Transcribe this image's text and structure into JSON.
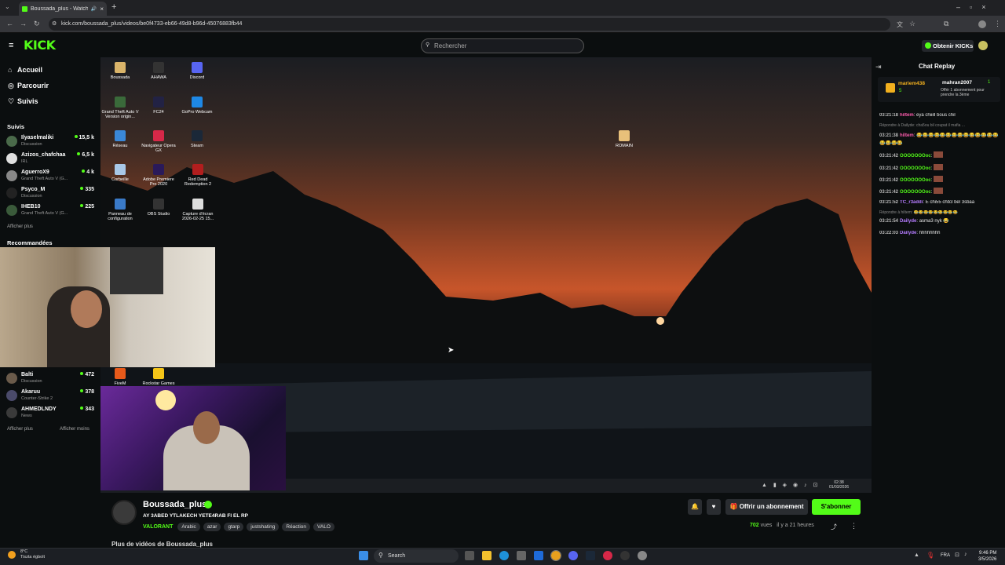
{
  "browser": {
    "tab_title": "Boussada_plus - Watch the",
    "url": "kick.com/boussada_plus/videos/be0f4733-eb66-49d8-b96d-45076883fb44",
    "new_tab": "+"
  },
  "header": {
    "logo": "KICK",
    "search_placeholder": "Rechercher",
    "kicks_button": "Obtenir KICKs"
  },
  "sidebar": {
    "nav": [
      {
        "label": "Accueil",
        "icon": "home-icon"
      },
      {
        "label": "Parcourir",
        "icon": "compass-icon"
      },
      {
        "label": "Suivis",
        "icon": "heart-icon"
      }
    ],
    "followed_title": "Suivis",
    "followed": [
      {
        "name": "Ilyaselmaliki",
        "category": "Discussion",
        "viewers": "15,5 k"
      },
      {
        "name": "Azizos_chafchaa",
        "category": "IRL",
        "viewers": "6,5 k"
      },
      {
        "name": "AguerroX9",
        "category": "Grand Theft Auto V (G...",
        "viewers": "4 k"
      },
      {
        "name": "Psyco_M",
        "category": "Discussion",
        "viewers": "335"
      },
      {
        "name": "IHEB10",
        "category": "Grand Theft Auto V (G...",
        "viewers": "225"
      }
    ],
    "show_more_1": "Afficher plus",
    "recommended_title": "Recommandées",
    "recommended": [
      {
        "name": "Balti",
        "category": "Discussion",
        "viewers": "472"
      },
      {
        "name": "Akaruu",
        "category": "Counter-Strike 2",
        "viewers": "378"
      },
      {
        "name": "AHMEDLNDY",
        "category": "News",
        "viewers": "343"
      }
    ],
    "show_more_2": "Afficher plus",
    "show_less": "Afficher moins"
  },
  "desktop": {
    "icons": [
      {
        "label": "Boussada",
        "color": "#d9b46a"
      },
      {
        "label": "AHAWA",
        "color": "#333333"
      },
      {
        "label": "Discord",
        "color": "#5865f2"
      },
      {
        "label": "Grand Theft Auto V Version origin...",
        "color": "#3a6a3a"
      },
      {
        "label": "FC24",
        "color": "#222244"
      },
      {
        "label": "GoPro Webcam",
        "color": "#1e88e5"
      },
      {
        "label": "Réseau",
        "color": "#3a88d8"
      },
      {
        "label": "Navigateur Opera GX",
        "color": "#d62848"
      },
      {
        "label": "Steam",
        "color": "#1b2838"
      },
      {
        "label": "Corbeille",
        "color": "#a8c8e8"
      },
      {
        "label": "Adobe Premiere Pro 2020",
        "color": "#2a1a5a"
      },
      {
        "label": "Red Dead Redemption 2",
        "color": "#b21e1e"
      },
      {
        "label": "Panneau de configuration",
        "color": "#3a7ac8"
      },
      {
        "label": "OBS Studio",
        "color": "#333333"
      },
      {
        "label": "Capture d'écran 2026-02-25 15...",
        "color": "#dddddd"
      },
      {
        "label": "ROMAIN",
        "color": "#e8c07a"
      },
      {
        "label": "FiveM",
        "color": "#e85a1a"
      },
      {
        "label": "Rockstar Games",
        "color": "#f5c518"
      }
    ],
    "tray_time": "02:38",
    "tray_date": "01/03/2026"
  },
  "chat": {
    "title": "Chat Replay",
    "pinned": {
      "user1": "mariem438",
      "count1": "5",
      "user2": "mahran2007",
      "count2": "1",
      "gift_text": "Offrir 1 abonnement pour prendre la 3ème"
    },
    "messages": [
      {
        "time": "03:21:18",
        "user": "hiltem",
        "user_color": "#ff5cae",
        "text": "eya chiiill bous chil"
      },
      {
        "reply": "Répondre à Dailyde: cha5ou bil coupat il mafia ..."
      },
      {
        "time": "03:21:38",
        "user": "hiltem",
        "user_color": "#ff5cae",
        "text": "😂😂😂😂😂😂😂😂😂😂😂😂😂😂😂😂😂😂"
      },
      {
        "time": "03:21:42",
        "user": "OOOOOOOoc",
        "user_color": "#53fc18",
        "text": ""
      },
      {
        "time": "03:21:42",
        "user": "OOOOOOOoc",
        "user_color": "#53fc18",
        "text": ""
      },
      {
        "time": "03:21:42",
        "user": "OOOOOOOoc",
        "user_color": "#53fc18",
        "text": ""
      },
      {
        "time": "03:21:42",
        "user": "OOOOOOOoc",
        "user_color": "#53fc18",
        "text": ""
      },
      {
        "time": "03:21:52",
        "user": "TC_r3addi",
        "user_color": "#b57cff",
        "text": "E chi55 chb3 bel 3sbaa"
      },
      {
        "reply": "Répondre à hiltem: 😂😂😂😂😂😂😂😂😂"
      },
      {
        "time": "03:21:54",
        "user": "Dailyde",
        "user_color": "#b57cff",
        "text": "asma3 nyk 😂"
      },
      {
        "time": "03:22:03",
        "user": "Dailyde",
        "user_color": "#b57cff",
        "text": "hhhhhhhh"
      }
    ]
  },
  "stream": {
    "channel": "Boussada_plus",
    "title": "AY 3ABED YTLAKECH YETE4RAB FI EL RP",
    "category": "VALORANT",
    "tags": [
      "Arabic",
      "azar",
      "gtarp",
      "justshating",
      "Réaction",
      "VALO"
    ],
    "gift_button": "Offrir un abonnement",
    "subscribe_button": "S'abonner",
    "views": "702",
    "views_label": "vues",
    "time_ago": "il y a 21 heures",
    "more_videos": "Plus de vidéos de Boussada_plus"
  },
  "taskbar": {
    "weather_temp": "8°C",
    "weather_desc": "Tiszta égbolt",
    "search": "Search",
    "lang": "FRA",
    "time": "9:46 PM",
    "date": "3/5/2026"
  },
  "colors": {
    "accent": "#53fc18",
    "bg": "#0b0e0f"
  }
}
